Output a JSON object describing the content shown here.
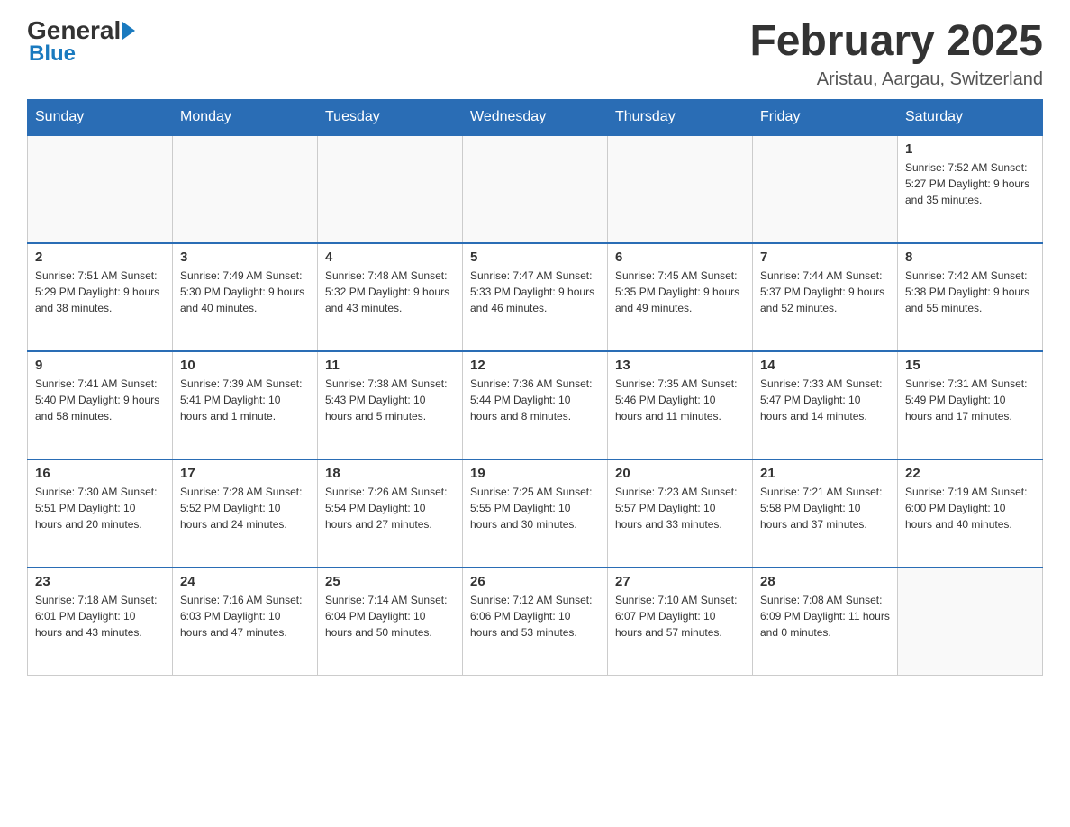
{
  "logo": {
    "general": "General",
    "blue": "Blue"
  },
  "title": "February 2025",
  "location": "Aristau, Aargau, Switzerland",
  "headers": [
    "Sunday",
    "Monday",
    "Tuesday",
    "Wednesday",
    "Thursday",
    "Friday",
    "Saturday"
  ],
  "weeks": [
    [
      {
        "day": "",
        "info": ""
      },
      {
        "day": "",
        "info": ""
      },
      {
        "day": "",
        "info": ""
      },
      {
        "day": "",
        "info": ""
      },
      {
        "day": "",
        "info": ""
      },
      {
        "day": "",
        "info": ""
      },
      {
        "day": "1",
        "info": "Sunrise: 7:52 AM\nSunset: 5:27 PM\nDaylight: 9 hours and 35 minutes."
      }
    ],
    [
      {
        "day": "2",
        "info": "Sunrise: 7:51 AM\nSunset: 5:29 PM\nDaylight: 9 hours and 38 minutes."
      },
      {
        "day": "3",
        "info": "Sunrise: 7:49 AM\nSunset: 5:30 PM\nDaylight: 9 hours and 40 minutes."
      },
      {
        "day": "4",
        "info": "Sunrise: 7:48 AM\nSunset: 5:32 PM\nDaylight: 9 hours and 43 minutes."
      },
      {
        "day": "5",
        "info": "Sunrise: 7:47 AM\nSunset: 5:33 PM\nDaylight: 9 hours and 46 minutes."
      },
      {
        "day": "6",
        "info": "Sunrise: 7:45 AM\nSunset: 5:35 PM\nDaylight: 9 hours and 49 minutes."
      },
      {
        "day": "7",
        "info": "Sunrise: 7:44 AM\nSunset: 5:37 PM\nDaylight: 9 hours and 52 minutes."
      },
      {
        "day": "8",
        "info": "Sunrise: 7:42 AM\nSunset: 5:38 PM\nDaylight: 9 hours and 55 minutes."
      }
    ],
    [
      {
        "day": "9",
        "info": "Sunrise: 7:41 AM\nSunset: 5:40 PM\nDaylight: 9 hours and 58 minutes."
      },
      {
        "day": "10",
        "info": "Sunrise: 7:39 AM\nSunset: 5:41 PM\nDaylight: 10 hours and 1 minute."
      },
      {
        "day": "11",
        "info": "Sunrise: 7:38 AM\nSunset: 5:43 PM\nDaylight: 10 hours and 5 minutes."
      },
      {
        "day": "12",
        "info": "Sunrise: 7:36 AM\nSunset: 5:44 PM\nDaylight: 10 hours and 8 minutes."
      },
      {
        "day": "13",
        "info": "Sunrise: 7:35 AM\nSunset: 5:46 PM\nDaylight: 10 hours and 11 minutes."
      },
      {
        "day": "14",
        "info": "Sunrise: 7:33 AM\nSunset: 5:47 PM\nDaylight: 10 hours and 14 minutes."
      },
      {
        "day": "15",
        "info": "Sunrise: 7:31 AM\nSunset: 5:49 PM\nDaylight: 10 hours and 17 minutes."
      }
    ],
    [
      {
        "day": "16",
        "info": "Sunrise: 7:30 AM\nSunset: 5:51 PM\nDaylight: 10 hours and 20 minutes."
      },
      {
        "day": "17",
        "info": "Sunrise: 7:28 AM\nSunset: 5:52 PM\nDaylight: 10 hours and 24 minutes."
      },
      {
        "day": "18",
        "info": "Sunrise: 7:26 AM\nSunset: 5:54 PM\nDaylight: 10 hours and 27 minutes."
      },
      {
        "day": "19",
        "info": "Sunrise: 7:25 AM\nSunset: 5:55 PM\nDaylight: 10 hours and 30 minutes."
      },
      {
        "day": "20",
        "info": "Sunrise: 7:23 AM\nSunset: 5:57 PM\nDaylight: 10 hours and 33 minutes."
      },
      {
        "day": "21",
        "info": "Sunrise: 7:21 AM\nSunset: 5:58 PM\nDaylight: 10 hours and 37 minutes."
      },
      {
        "day": "22",
        "info": "Sunrise: 7:19 AM\nSunset: 6:00 PM\nDaylight: 10 hours and 40 minutes."
      }
    ],
    [
      {
        "day": "23",
        "info": "Sunrise: 7:18 AM\nSunset: 6:01 PM\nDaylight: 10 hours and 43 minutes."
      },
      {
        "day": "24",
        "info": "Sunrise: 7:16 AM\nSunset: 6:03 PM\nDaylight: 10 hours and 47 minutes."
      },
      {
        "day": "25",
        "info": "Sunrise: 7:14 AM\nSunset: 6:04 PM\nDaylight: 10 hours and 50 minutes."
      },
      {
        "day": "26",
        "info": "Sunrise: 7:12 AM\nSunset: 6:06 PM\nDaylight: 10 hours and 53 minutes."
      },
      {
        "day": "27",
        "info": "Sunrise: 7:10 AM\nSunset: 6:07 PM\nDaylight: 10 hours and 57 minutes."
      },
      {
        "day": "28",
        "info": "Sunrise: 7:08 AM\nSunset: 6:09 PM\nDaylight: 11 hours and 0 minutes."
      },
      {
        "day": "",
        "info": ""
      }
    ]
  ]
}
